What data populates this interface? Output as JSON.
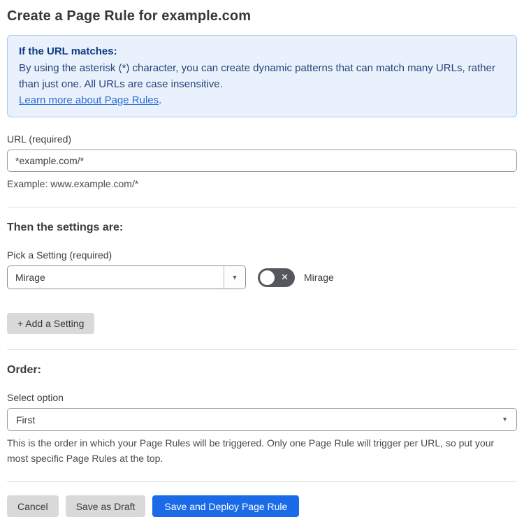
{
  "page": {
    "title": "Create a Page Rule for example.com"
  },
  "info_box": {
    "heading": "If the URL matches:",
    "body": "By using the asterisk (*) character, you can create dynamic patterns that can match many URLs, rather than just one. All URLs are case insensitive.",
    "link_label": "Learn more about Page Rules",
    "link_suffix": "."
  },
  "url_field": {
    "label": "URL (required)",
    "value": "*example.com/*",
    "helper": "Example: www.example.com/*"
  },
  "settings_section": {
    "heading": "Then the settings are:",
    "picker_label": "Pick a Setting (required)",
    "selected_setting": "Mirage",
    "toggle_label": "Mirage",
    "toggle_state": "off",
    "add_button_label": "+ Add a Setting"
  },
  "order_section": {
    "heading": "Order:",
    "select_label": "Select option",
    "selected_option": "First",
    "helper": "This is the order in which your Page Rules will be triggered. Only one Page Rule will trigger per URL, so put your most specific Page Rules at the top."
  },
  "footer": {
    "cancel_label": "Cancel",
    "save_draft_label": "Save as Draft",
    "save_deploy_label": "Save and Deploy Page Rule"
  },
  "icons": {
    "dropdown_arrow": "▼",
    "toggle_x": "✕"
  },
  "colors": {
    "primary_blue": "#1b6be9",
    "info_background": "#e9f2fc",
    "info_border": "#a8c9ee",
    "info_heading_text": "#0d3a81",
    "info_body_text": "#27427b",
    "link_blue": "#2e6bd6",
    "toggle_off_background": "#55575c",
    "gray_button_background": "#d9d9d9"
  }
}
